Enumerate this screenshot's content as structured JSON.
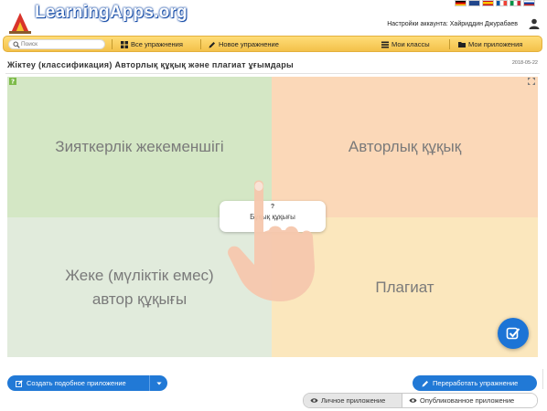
{
  "header": {
    "logo_text": "LearningApps.org",
    "account_label": "Настройки аккаунта:",
    "account_name": "Хайриддин Джурабаев",
    "flags": [
      "de",
      "gb",
      "es",
      "fr",
      "it",
      "ru"
    ]
  },
  "navbar": {
    "search_placeholder": "Поиск",
    "items": [
      {
        "label": "Все упражнения",
        "icon": "grid-icon"
      },
      {
        "label": "Новое упражнение",
        "icon": "pencil-icon"
      },
      {
        "label": "Мои классы",
        "icon": "list-icon"
      },
      {
        "label": "Мои приложения",
        "icon": "folder-icon"
      }
    ]
  },
  "app": {
    "title": "Жіктеу (классификация) Авторлық құқық және плагиат ұғымдары",
    "date": "2018-05-22",
    "quadrants": [
      {
        "label_lines": [
          "Зияткерлік жекеменшігі"
        ],
        "color": "#d4e7c5"
      },
      {
        "label_lines": [
          "Авторлық құқық"
        ],
        "color": "#fbd8b8"
      },
      {
        "label_lines": [
          "Жеке (мүліктік емес)",
          "автор құқығы"
        ],
        "color": "#e1ebdc"
      },
      {
        "label_lines": [
          "Плагиат"
        ],
        "color": "#fbe7bd"
      }
    ],
    "card": {
      "marker": "?",
      "text": "Бұқық құқығы"
    },
    "check_icon": "check-square-icon"
  },
  "footer": {
    "create_similar_label": "Создать подобное приложение",
    "rework_label": "Переработать упражнение",
    "visibility": {
      "private_label": "Личное приложение",
      "public_label": "Опубликованное приложение",
      "selected": "private"
    }
  },
  "colors": {
    "accent_blue": "#2179d6",
    "nav_yellow": "#f3c14a"
  }
}
